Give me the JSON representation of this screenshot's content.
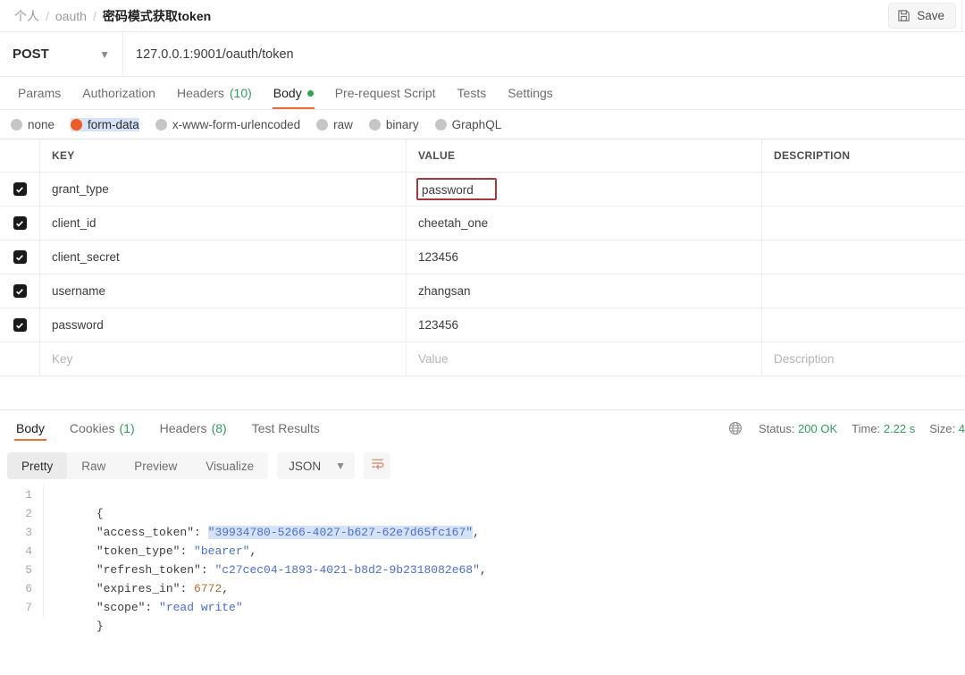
{
  "breadcrumb": {
    "workspace": "个人",
    "collection": "oauth",
    "request": "密码模式获取token",
    "separator": "/"
  },
  "toolbar": {
    "save_label": "Save",
    "save_icon": "floppy-disk-icon"
  },
  "request": {
    "method": "POST",
    "url": "127.0.0.1:9001/oauth/token",
    "tabs": [
      {
        "label": "Params",
        "count": "",
        "active": false
      },
      {
        "label": "Authorization",
        "count": "",
        "active": false
      },
      {
        "label": "Headers",
        "count": "(10)",
        "active": false
      },
      {
        "label": "Body",
        "count": "",
        "active": true,
        "dot": true
      },
      {
        "label": "Pre-request Script",
        "count": "",
        "active": false
      },
      {
        "label": "Tests",
        "count": "",
        "active": false
      },
      {
        "label": "Settings",
        "count": "",
        "active": false
      }
    ],
    "body_types": [
      {
        "label": "none",
        "selected": false
      },
      {
        "label": "form-data",
        "selected": true
      },
      {
        "label": "x-www-form-urlencoded",
        "selected": false
      },
      {
        "label": "raw",
        "selected": false
      },
      {
        "label": "binary",
        "selected": false
      },
      {
        "label": "GraphQL",
        "selected": false
      }
    ],
    "table": {
      "headers": {
        "key": "KEY",
        "value": "VALUE",
        "description": "DESCRIPTION"
      },
      "placeholders": {
        "key": "Key",
        "value": "Value",
        "description": "Description"
      },
      "rows": [
        {
          "checked": true,
          "key": "grant_type",
          "value": "password",
          "description": "",
          "annotated": true
        },
        {
          "checked": true,
          "key": "client_id",
          "value": "cheetah_one",
          "description": ""
        },
        {
          "checked": true,
          "key": "client_secret",
          "value": "123456",
          "description": ""
        },
        {
          "checked": true,
          "key": "username",
          "value": "zhangsan",
          "description": ""
        },
        {
          "checked": true,
          "key": "password",
          "value": "123456",
          "description": ""
        }
      ]
    }
  },
  "response": {
    "tabs": [
      {
        "label": "Body",
        "count": "",
        "active": true
      },
      {
        "label": "Cookies",
        "count": "(1)",
        "active": false
      },
      {
        "label": "Headers",
        "count": "(8)",
        "active": false
      },
      {
        "label": "Test Results",
        "count": "",
        "active": false
      }
    ],
    "status": {
      "globe_icon": "globe-icon",
      "status_label": "Status:",
      "status_value": "200 OK",
      "time_label": "Time:",
      "time_value": "2.22 s",
      "size_label": "Size:",
      "size_value": "4"
    },
    "view_modes": [
      {
        "label": "Pretty",
        "active": true
      },
      {
        "label": "Raw",
        "active": false
      },
      {
        "label": "Preview",
        "active": false
      },
      {
        "label": "Visualize",
        "active": false
      }
    ],
    "format": "JSON",
    "wrap_icon": "word-wrap-icon",
    "line_numbers": [
      "1",
      "2",
      "3",
      "4",
      "5",
      "6",
      "7"
    ],
    "json": {
      "access_token": "39934780-5266-4027-b627-62e7d65fc167",
      "token_type": "bearer",
      "refresh_token": "c27cec04-1893-4021-b8d2-9b2318082e68",
      "expires_in": "6772",
      "scope": "read write"
    },
    "json_lines": {
      "l1": "{",
      "l2_key": "\"access_token\"",
      "l2_val": "\"39934780-5266-4027-b627-62e7d65fc167\"",
      "l3_key": "\"token_type\"",
      "l3_val": "\"bearer\"",
      "l4_key": "\"refresh_token\"",
      "l4_val": "\"c27cec04-1893-4021-b8d2-9b2318082e68\"",
      "l5_key": "\"expires_in\"",
      "l5_val": "6772",
      "l6_key": "\"scope\"",
      "l6_val": "\"read write\"",
      "l7": "}",
      "colon": ": ",
      "comma": ","
    }
  },
  "colors": {
    "accent": "#ef6c35",
    "success": "#2aa94f",
    "annotation": "#a33b3b",
    "string": "#4a6fd4"
  }
}
